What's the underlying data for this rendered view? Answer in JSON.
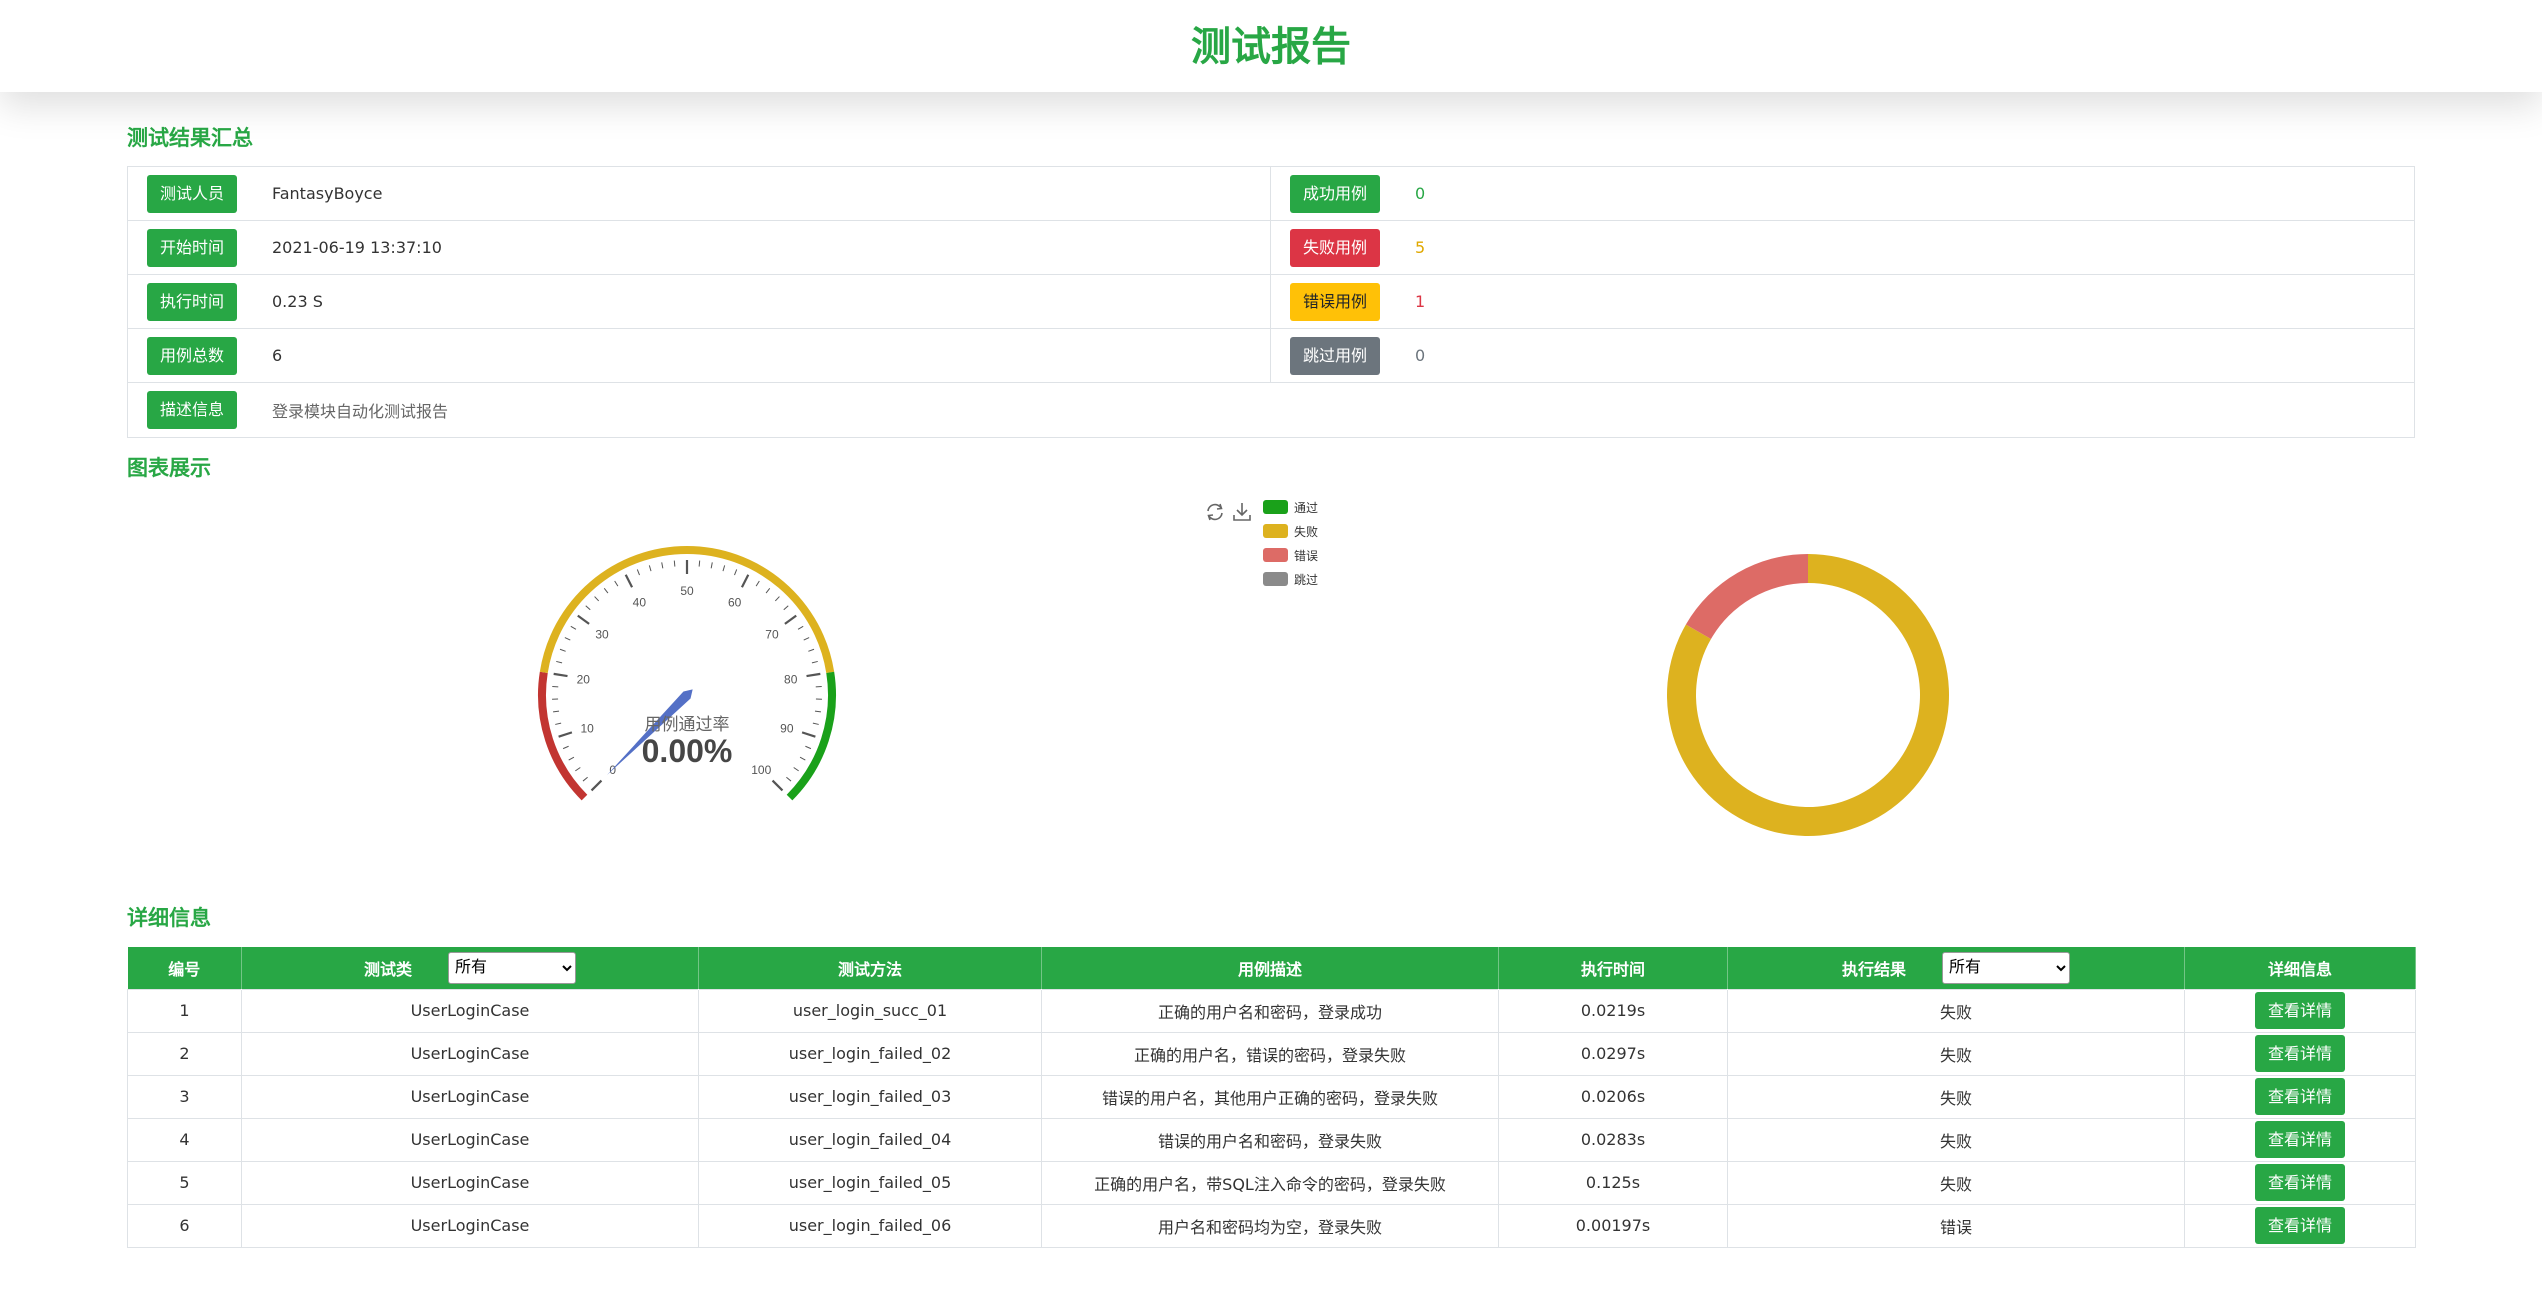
{
  "page_title": "测试报告",
  "sections": {
    "summary": "测试结果汇总",
    "charts": "图表展示",
    "details": "详细信息"
  },
  "summary": {
    "tester_label": "测试人员",
    "tester": "FantasyBoyce",
    "start_label": "开始时间",
    "start_time": "2021-06-19 13:37:10",
    "duration_label": "执行时间",
    "duration": "0.23 S",
    "total_label": "用例总数",
    "total": "6",
    "success_label": "成功用例",
    "success": "0",
    "failed_label": "失败用例",
    "failed": "5",
    "error_label": "错误用例",
    "error": "1",
    "skipped_label": "跳过用例",
    "skipped": "0",
    "desc_label": "描述信息",
    "desc": "登录模块自动化测试报告"
  },
  "gauge": {
    "title": "用例通过率",
    "value_text": "0.00%",
    "value": 0,
    "min": 0,
    "max": 100,
    "tick_labels": [
      "0",
      "10",
      "20",
      "30",
      "40",
      "50",
      "60",
      "70",
      "80",
      "90",
      "100"
    ],
    "band_colors": [
      "#c23531",
      "#ddb21f",
      "#1aa11a"
    ]
  },
  "toolbox": {
    "refresh_icon": "refresh-icon",
    "download_icon": "download-icon"
  },
  "chart_data": {
    "type": "pie",
    "donut": true,
    "categories": [
      "通过",
      "失败",
      "错误",
      "跳过"
    ],
    "values": [
      0,
      5,
      1,
      0
    ],
    "colors": [
      "#1aa11a",
      "#ddb21f",
      "#dd6b66",
      "#8a8a8a"
    ],
    "legend_position": "top-center"
  },
  "table": {
    "headers": {
      "id": "编号",
      "class": "测试类",
      "method": "测试方法",
      "desc": "用例描述",
      "time": "执行时间",
      "result": "执行结果",
      "detail": "详细信息"
    },
    "class_filter": "所有",
    "result_filter": "所有",
    "detail_button": "查看详情",
    "rows": [
      {
        "id": "1",
        "class": "UserLoginCase",
        "method": "user_login_succ_01",
        "desc": "正确的用户名和密码，登录成功",
        "time": "0.0219s",
        "result": "失败",
        "status": "fail"
      },
      {
        "id": "2",
        "class": "UserLoginCase",
        "method": "user_login_failed_02",
        "desc": "正确的用户名，错误的密码，登录失败",
        "time": "0.0297s",
        "result": "失败",
        "status": "fail"
      },
      {
        "id": "3",
        "class": "UserLoginCase",
        "method": "user_login_failed_03",
        "desc": "错误的用户名，其他用户正确的密码，登录失败",
        "time": "0.0206s",
        "result": "失败",
        "status": "fail"
      },
      {
        "id": "4",
        "class": "UserLoginCase",
        "method": "user_login_failed_04",
        "desc": "错误的用户名和密码，登录失败",
        "time": "0.0283s",
        "result": "失败",
        "status": "fail"
      },
      {
        "id": "5",
        "class": "UserLoginCase",
        "method": "user_login_failed_05",
        "desc": "正确的用户名，带SQL注入命令的密码，登录失败",
        "time": "0.125s",
        "result": "失败",
        "status": "fail"
      },
      {
        "id": "6",
        "class": "UserLoginCase",
        "method": "user_login_failed_06",
        "desc": "用户名和密码均为空，登录失败",
        "time": "0.00197s",
        "result": "错误",
        "status": "error"
      }
    ]
  }
}
